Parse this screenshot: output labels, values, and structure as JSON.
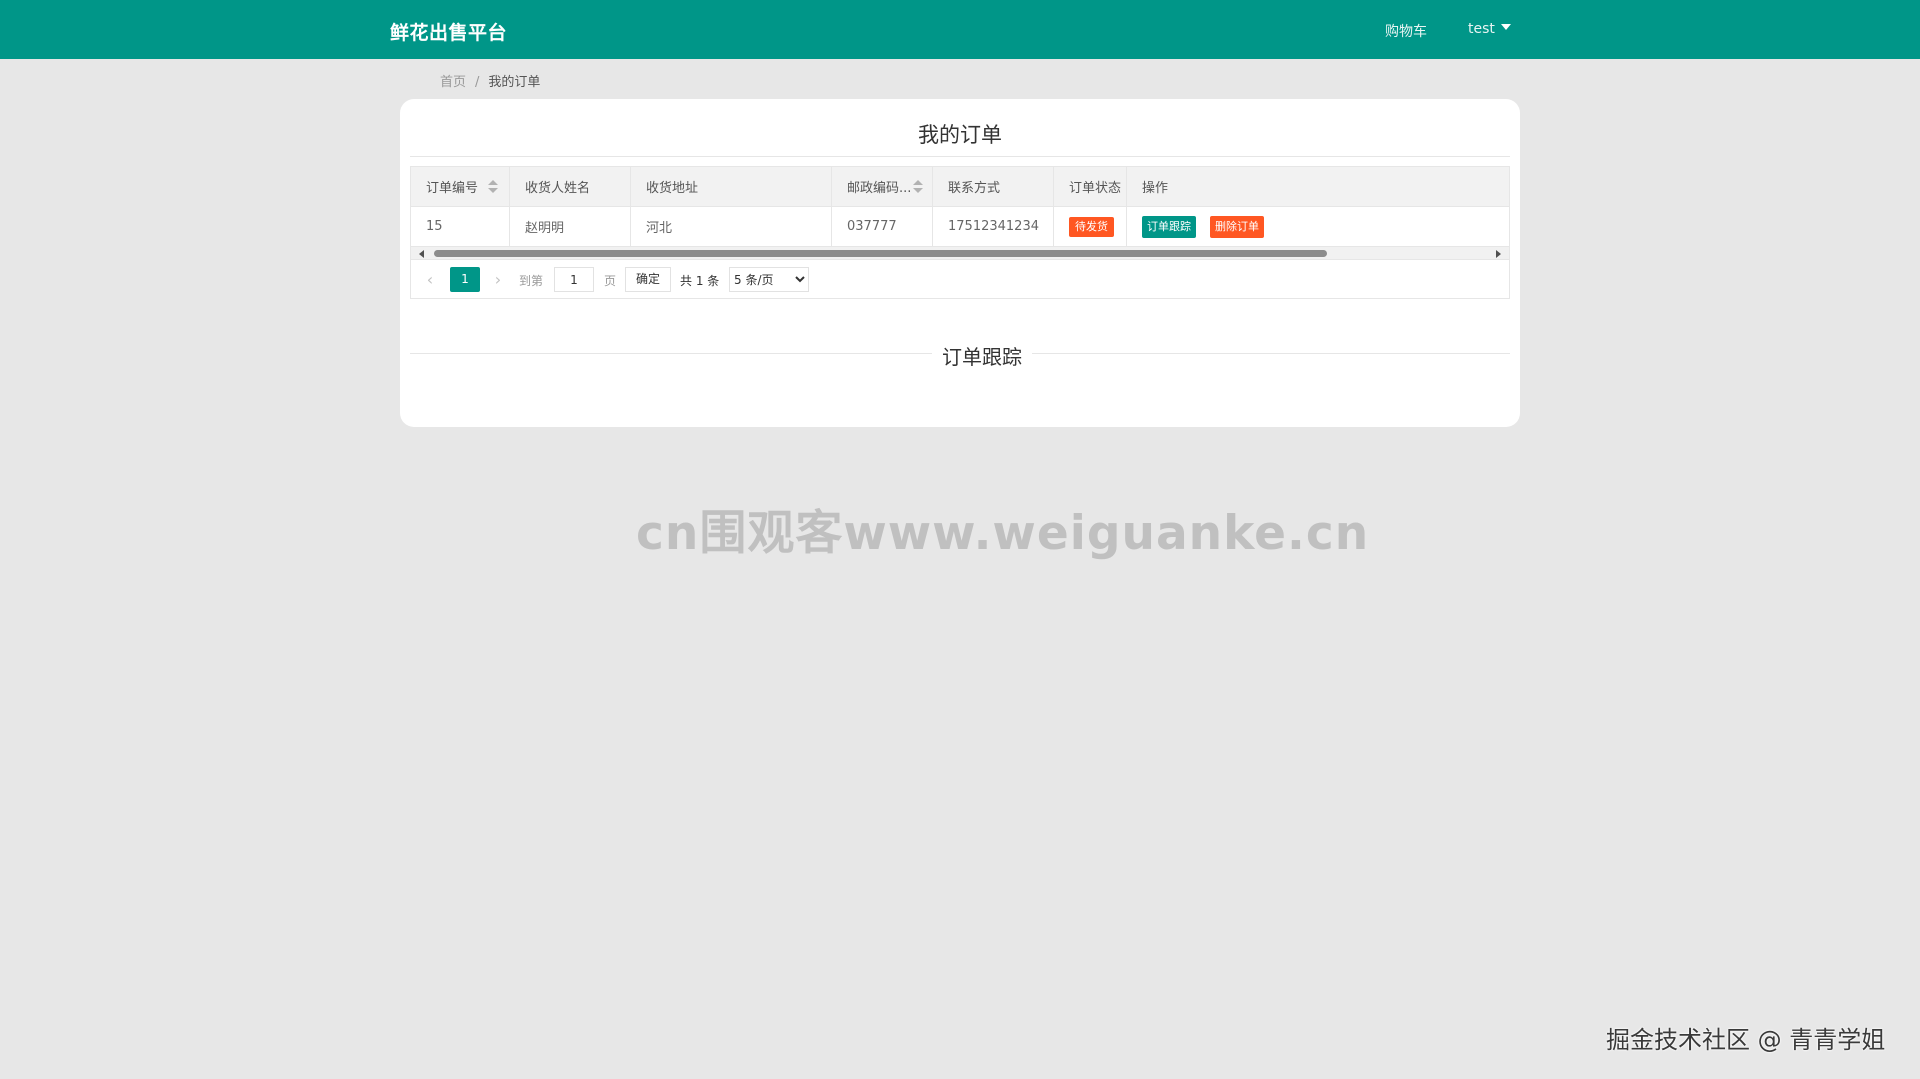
{
  "header": {
    "logo": "鲜花出售平台",
    "cart_label": "购物车",
    "user_label": "test"
  },
  "breadcrumb": {
    "home": "首页",
    "separator": "/",
    "current": "我的订单"
  },
  "card": {
    "title": "我的订单"
  },
  "table": {
    "columns": [
      "订单编号",
      "收货人姓名",
      "收货地址",
      "邮政编码...",
      "联系方式",
      "订单状态",
      "操作"
    ],
    "rows": [
      {
        "order_id": "15",
        "recipient": "赵明明",
        "address": "河北",
        "postal_code": "037777",
        "phone": "17512341234",
        "status": "待发货",
        "actions": [
          "订单跟踪",
          "删除订单"
        ]
      }
    ]
  },
  "pagination": {
    "prev_icon": "chevron-left-icon",
    "current_page": "1",
    "next_icon": "chevron-right-icon",
    "goto_label": "到第",
    "goto_value": "1",
    "page_suffix": "页",
    "confirm_label": "确定",
    "total_label": "共 1 条",
    "page_size_options": [
      "5 条/页"
    ],
    "page_size_selected": "5 条/页"
  },
  "tracking": {
    "title": "订单跟踪"
  },
  "watermarks": {
    "center": "cn围观客www.weiguanke.cn",
    "corner": "掘金技术社区 @ 青青学姐"
  },
  "colors": {
    "primary": "#009688",
    "danger": "#ff5722",
    "background": "#e7e7e7"
  }
}
